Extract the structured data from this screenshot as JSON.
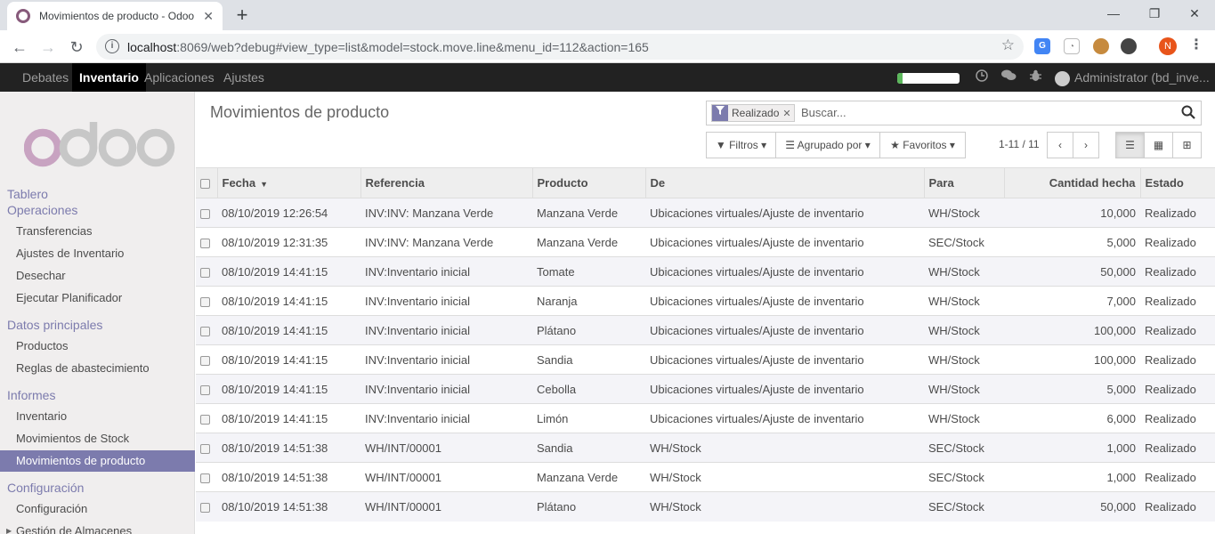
{
  "browser": {
    "tab_title": "Movimientos de producto - Odoo",
    "url_host": "localhost",
    "url_rest": ":8069/web?debug#view_type=list&model=stock.move.line&menu_id=112&action=165",
    "profile_initial": "N"
  },
  "navbar": {
    "items": [
      "Debates",
      "Inventario",
      "Aplicaciones",
      "Ajustes"
    ],
    "active": "Inventario",
    "progress": 0.08,
    "user": "Administrator (bd_inve..."
  },
  "sidebar": {
    "logo_text": "odoo",
    "sections": [
      {
        "title": "Tablero",
        "items": []
      },
      {
        "title": "Operaciones",
        "items": [
          "Transferencias",
          "Ajustes de Inventario",
          "Desechar",
          "Ejecutar Planificador"
        ]
      },
      {
        "title": "Datos principales",
        "items": [
          "Productos",
          "Reglas de abastecimiento"
        ]
      },
      {
        "title": "Informes",
        "items": [
          "Inventario",
          "Movimientos de Stock",
          "Movimientos de producto"
        ]
      },
      {
        "title": "Configuración",
        "items": [
          "Configuración",
          "Gestión de Almacenes"
        ]
      }
    ],
    "active_item": "Movimientos de producto"
  },
  "control": {
    "breadcrumb": "Movimientos de producto",
    "facet": "Realizado",
    "search_placeholder": "Buscar...",
    "filters_label": "Filtros",
    "groupby_label": "Agrupado por",
    "favorites_label": "Favoritos",
    "pager": "1-11 / 11"
  },
  "table": {
    "headers": [
      "Fecha",
      "Referencia",
      "Producto",
      "De",
      "Para",
      "Cantidad hecha",
      "Estado"
    ],
    "rows": [
      [
        "08/10/2019 12:26:54",
        "INV:INV: Manzana Verde",
        "Manzana Verde",
        "Ubicaciones virtuales/Ajuste de inventario",
        "WH/Stock",
        "10,000",
        "Realizado"
      ],
      [
        "08/10/2019 12:31:35",
        "INV:INV: Manzana Verde",
        "Manzana Verde",
        "Ubicaciones virtuales/Ajuste de inventario",
        "SEC/Stock",
        "5,000",
        "Realizado"
      ],
      [
        "08/10/2019 14:41:15",
        "INV:Inventario inicial",
        "Tomate",
        "Ubicaciones virtuales/Ajuste de inventario",
        "WH/Stock",
        "50,000",
        "Realizado"
      ],
      [
        "08/10/2019 14:41:15",
        "INV:Inventario inicial",
        "Naranja",
        "Ubicaciones virtuales/Ajuste de inventario",
        "WH/Stock",
        "7,000",
        "Realizado"
      ],
      [
        "08/10/2019 14:41:15",
        "INV:Inventario inicial",
        "Plátano",
        "Ubicaciones virtuales/Ajuste de inventario",
        "WH/Stock",
        "100,000",
        "Realizado"
      ],
      [
        "08/10/2019 14:41:15",
        "INV:Inventario inicial",
        "Sandia",
        "Ubicaciones virtuales/Ajuste de inventario",
        "WH/Stock",
        "100,000",
        "Realizado"
      ],
      [
        "08/10/2019 14:41:15",
        "INV:Inventario inicial",
        "Cebolla",
        "Ubicaciones virtuales/Ajuste de inventario",
        "WH/Stock",
        "5,000",
        "Realizado"
      ],
      [
        "08/10/2019 14:41:15",
        "INV:Inventario inicial",
        "Limón",
        "Ubicaciones virtuales/Ajuste de inventario",
        "WH/Stock",
        "6,000",
        "Realizado"
      ],
      [
        "08/10/2019 14:51:38",
        "WH/INT/00001",
        "Sandia",
        "WH/Stock",
        "SEC/Stock",
        "1,000",
        "Realizado"
      ],
      [
        "08/10/2019 14:51:38",
        "WH/INT/00001",
        "Manzana Verde",
        "WH/Stock",
        "SEC/Stock",
        "1,000",
        "Realizado"
      ],
      [
        "08/10/2019 14:51:38",
        "WH/INT/00001",
        "Plátano",
        "WH/Stock",
        "SEC/Stock",
        "50,000",
        "Realizado"
      ]
    ]
  },
  "colors": {
    "brand": "#875a7b",
    "sidebar_accent": "#7c7bad",
    "navbar_bg": "#222222"
  }
}
